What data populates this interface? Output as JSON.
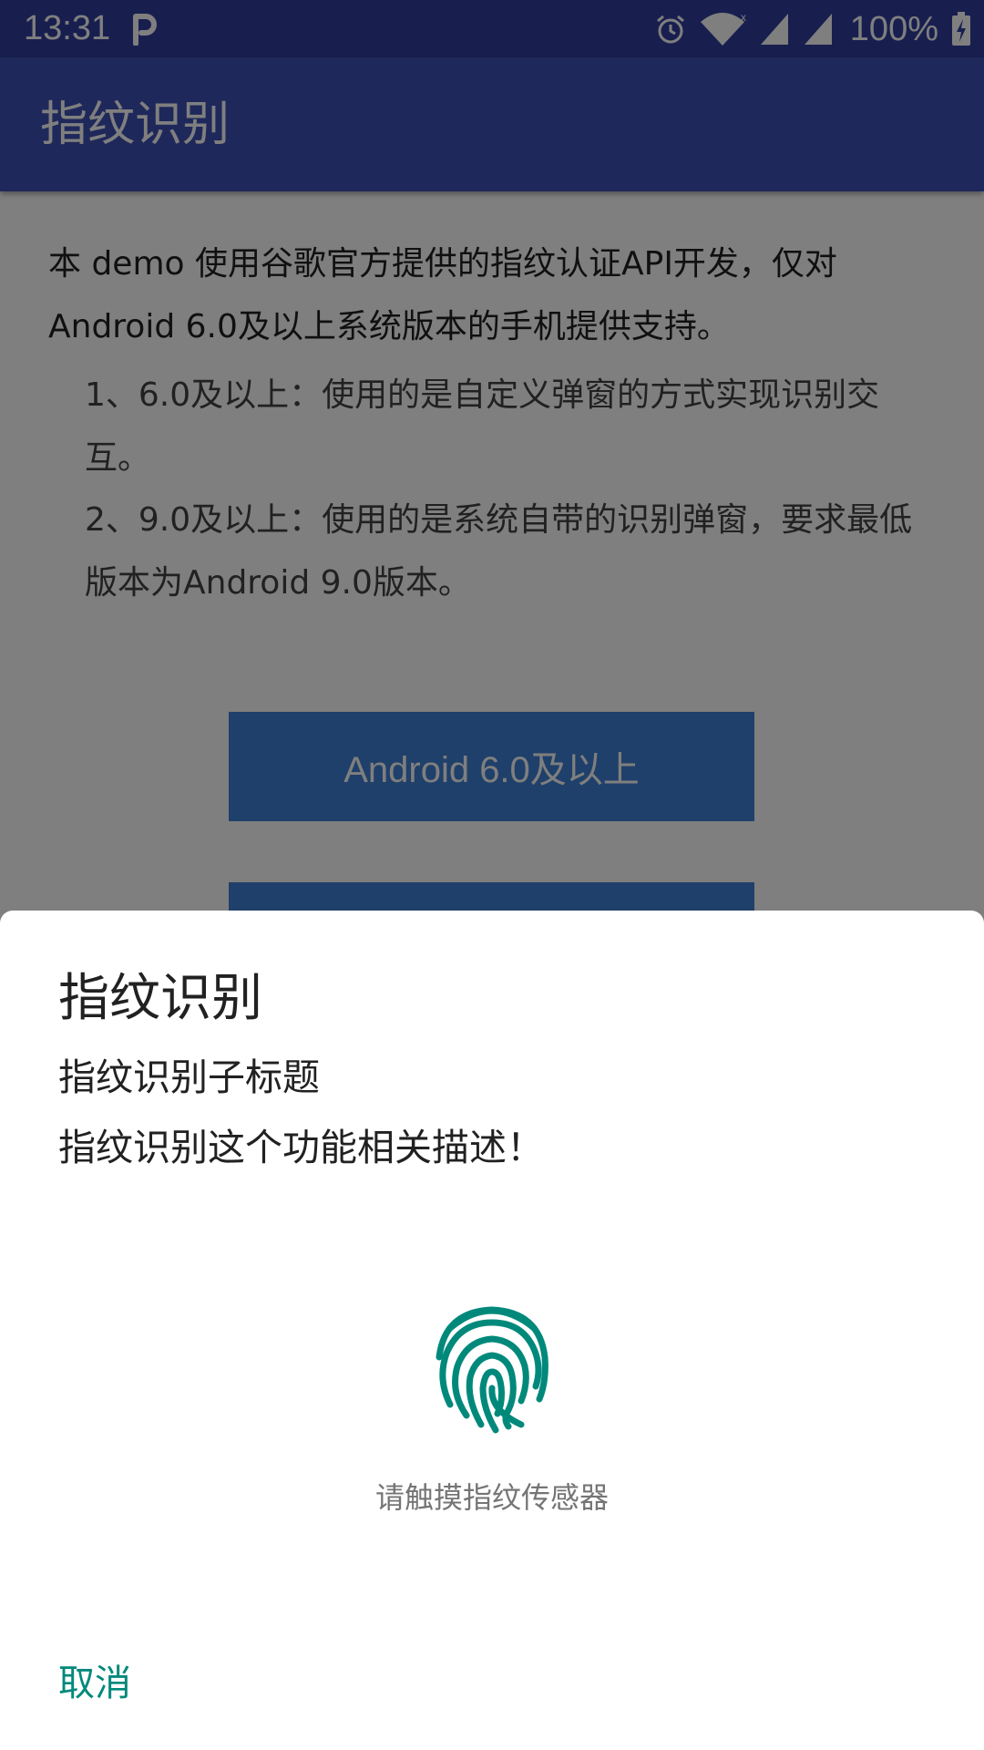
{
  "status_bar": {
    "time": "13:31",
    "battery_text": "100%",
    "icons": [
      "parking-icon",
      "alarm-icon",
      "wifi-icon",
      "signal-icon",
      "signal-icon",
      "battery-icon"
    ]
  },
  "app_bar": {
    "title": "指纹识别"
  },
  "main": {
    "intro": "本 demo 使用谷歌官方提供的指纹认证API开发，仅对Android 6.0及以上系统版本的手机提供支持。",
    "bullets": [
      "1、6.0及以上：使用的是自定义弹窗的方式实现识别交互。",
      " 2、9.0及以上：使用的是系统自带的识别弹窗，要求最低版本为Android 9.0版本。"
    ],
    "buttons": [
      "Android 6.0及以上",
      ""
    ]
  },
  "dialog": {
    "title": "指纹识别",
    "subtitle": "指纹识别子标题",
    "description": "指纹识别这个功能相关描述！",
    "hint": "请触摸指纹传感器",
    "cancel_label": "取消",
    "icon": "fingerprint-icon"
  },
  "colors": {
    "status_bar": "#303f9f",
    "app_bar": "#3f51b5",
    "button": "#3f81d5",
    "accent": "#00897b",
    "scrim": "rgba(0,0,0,0.5)"
  }
}
